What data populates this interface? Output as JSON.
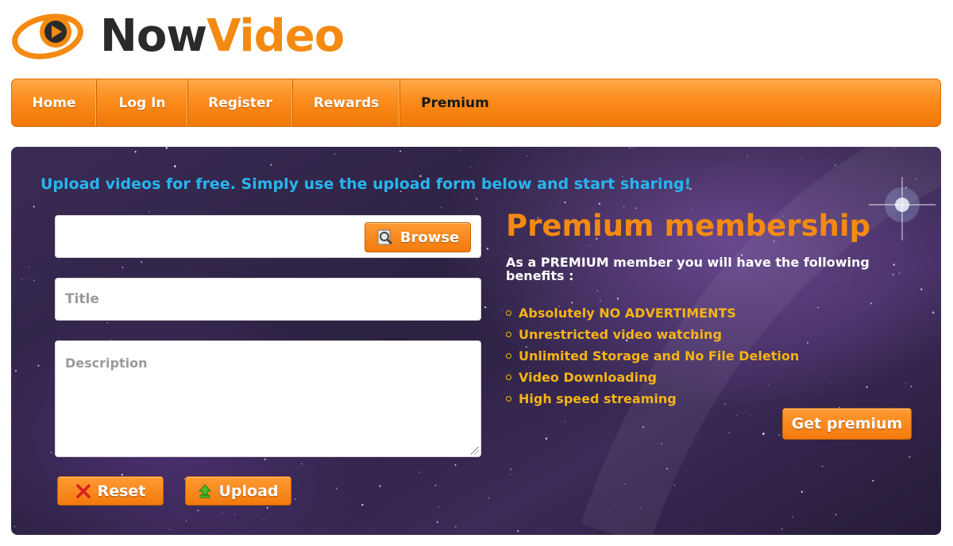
{
  "brand": {
    "name_part1": "Now",
    "name_part2": "Video",
    "accent": "#f58a12",
    "dark": "#2a2a2a",
    "logo_icon": "play-icon"
  },
  "nav": {
    "items": [
      {
        "label": "Home"
      },
      {
        "label": "Log In"
      },
      {
        "label": "Register"
      },
      {
        "label": "Rewards"
      },
      {
        "label": "Premium"
      }
    ],
    "active": "Premium"
  },
  "upload": {
    "headline": "Upload videos for free. Simply use the upload form below and start sharing!",
    "browse_label": "Browse",
    "browse_icon": "magnifier-file-icon",
    "title_placeholder": "Title",
    "description_placeholder": "Description",
    "reset_label": "Reset",
    "reset_icon": "x-icon",
    "upload_label": "Upload",
    "upload_icon": "up-arrow-icon"
  },
  "premium": {
    "title": "Premium membership",
    "intro": "As a PREMIUM member you will have the following benefits :",
    "benefits": [
      "Absolutely NO ADVERTIMENTS",
      "Unrestricted video watching",
      "Unlimited Storage and No File Deletion",
      "Video Downloading",
      "High speed streaming"
    ],
    "cta_label": "Get premium"
  },
  "colors": {
    "headline": "#27b5ef",
    "benefit": "#f5b417",
    "button": "#f37a0c"
  }
}
